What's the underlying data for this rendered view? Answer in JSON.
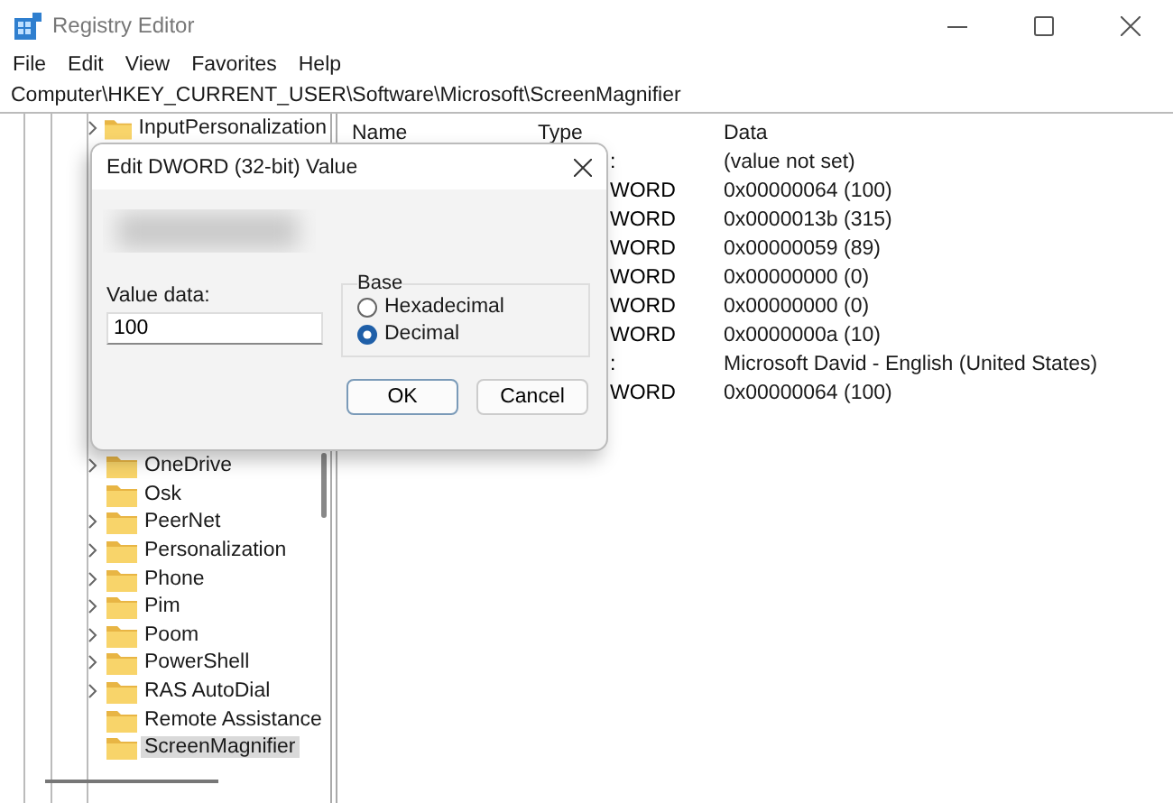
{
  "window": {
    "title": "Registry Editor"
  },
  "menu": [
    "File",
    "Edit",
    "View",
    "Favorites",
    "Help"
  ],
  "address": "Computer\\HKEY_CURRENT_USER\\Software\\Microsoft\\ScreenMagnifier",
  "tree": {
    "top_items": [
      {
        "label": "InputPersonalization",
        "expandable": true,
        "selected": false
      }
    ],
    "bottom_items": [
      {
        "label": "OneDrive",
        "expandable": true,
        "selected": false
      },
      {
        "label": "Osk",
        "expandable": false,
        "selected": false
      },
      {
        "label": "PeerNet",
        "expandable": true,
        "selected": false
      },
      {
        "label": "Personalization",
        "expandable": true,
        "selected": false
      },
      {
        "label": "Phone",
        "expandable": true,
        "selected": false
      },
      {
        "label": "Pim",
        "expandable": true,
        "selected": false
      },
      {
        "label": "Poom",
        "expandable": true,
        "selected": false
      },
      {
        "label": "PowerShell",
        "expandable": true,
        "selected": false
      },
      {
        "label": "RAS AutoDial",
        "expandable": true,
        "selected": false
      },
      {
        "label": "Remote Assistance",
        "expandable": false,
        "selected": false
      },
      {
        "label": "ScreenMagnifier",
        "expandable": false,
        "selected": true
      }
    ]
  },
  "values": {
    "columns": [
      "Name",
      "Type",
      "Data"
    ],
    "rows": [
      {
        "type": ":",
        "data": "(value not set)"
      },
      {
        "type": "WORD",
        "data": "0x00000064 (100)"
      },
      {
        "type": "WORD",
        "data": "0x0000013b (315)"
      },
      {
        "type": "WORD",
        "data": "0x00000059 (89)"
      },
      {
        "type": "WORD",
        "data": "0x00000000 (0)"
      },
      {
        "type": "WORD",
        "data": "0x00000000 (0)"
      },
      {
        "type": "WORD",
        "data": "0x0000000a (10)"
      },
      {
        "type": ":",
        "data": "Microsoft David - English (United States)"
      },
      {
        "type": "WORD",
        "data": "0x00000064 (100)"
      }
    ]
  },
  "dialog": {
    "title": "Edit DWORD (32-bit) Value",
    "value_data_label": "Value data:",
    "value_data": "100",
    "base_label": "Base",
    "bases": [
      {
        "label": "Hexadecimal",
        "selected": false
      },
      {
        "label": "Decimal",
        "selected": true
      }
    ],
    "buttons": [
      {
        "label": "OK",
        "default": true
      },
      {
        "label": "Cancel",
        "default": false
      }
    ]
  }
}
